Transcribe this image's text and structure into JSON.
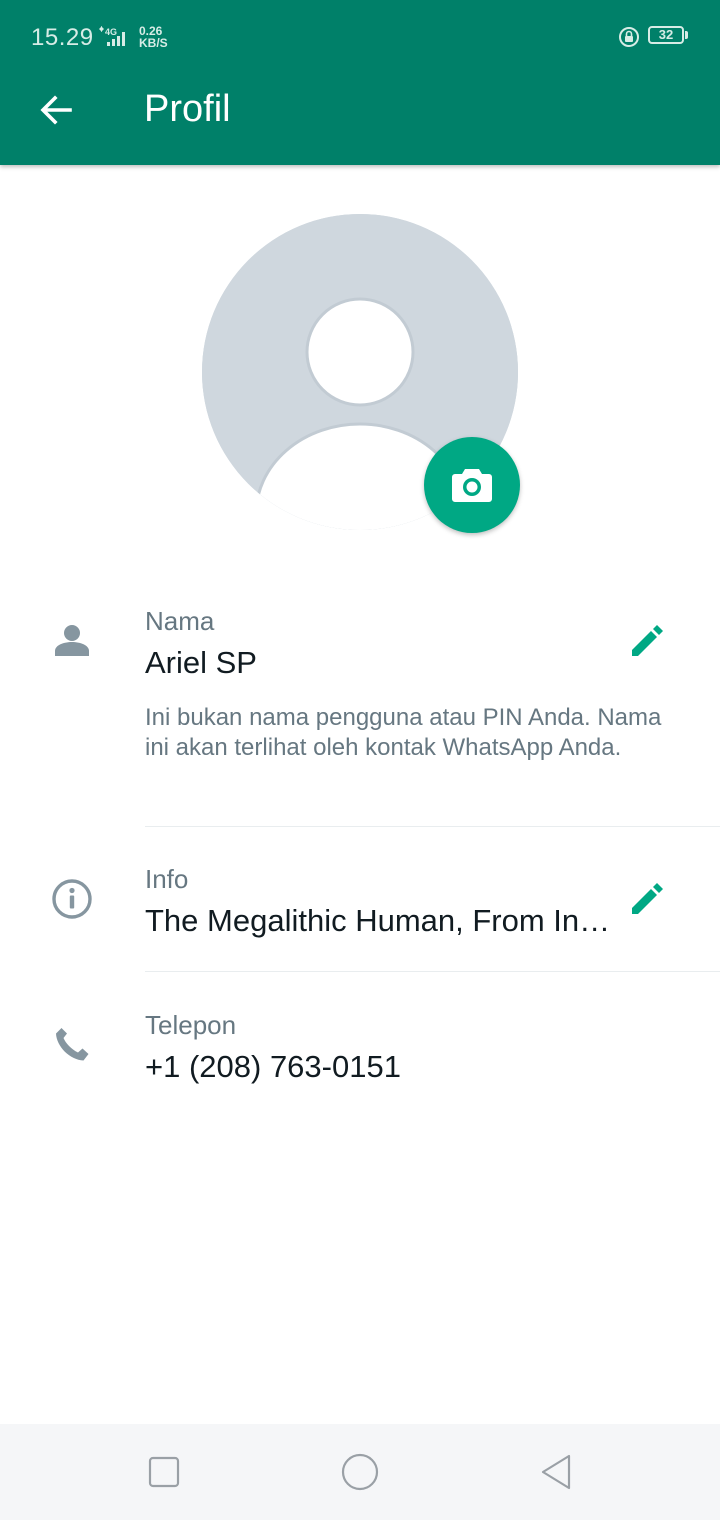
{
  "status_bar": {
    "time": "15.29",
    "network": "4G",
    "speed_value": "0.26",
    "speed_unit": "KB/S",
    "battery": "32"
  },
  "header": {
    "title": "Profil",
    "back_icon": "arrow-left-icon"
  },
  "profile": {
    "avatar_icon": "default-avatar-icon",
    "camera_icon": "camera-icon",
    "accent_color": "#00a884",
    "header_color": "#008069"
  },
  "fields": {
    "name": {
      "label": "Nama",
      "value": "Ariel SP",
      "hint": "Ini bukan nama pengguna atau PIN Anda. Nama ini akan terlihat oleh kontak WhatsApp Anda.",
      "icon": "person-icon",
      "edit_icon": "pencil-icon"
    },
    "info": {
      "label": "Info",
      "value": "The Megalithic Human, From In…",
      "icon": "info-icon",
      "edit_icon": "pencil-icon"
    },
    "phone": {
      "label": "Telepon",
      "value": "+1 (208) 763-0151",
      "icon": "phone-icon"
    }
  },
  "nav_bar": {
    "recents_icon": "square-icon",
    "home_icon": "circle-icon",
    "back_icon": "triangle-back-icon"
  }
}
